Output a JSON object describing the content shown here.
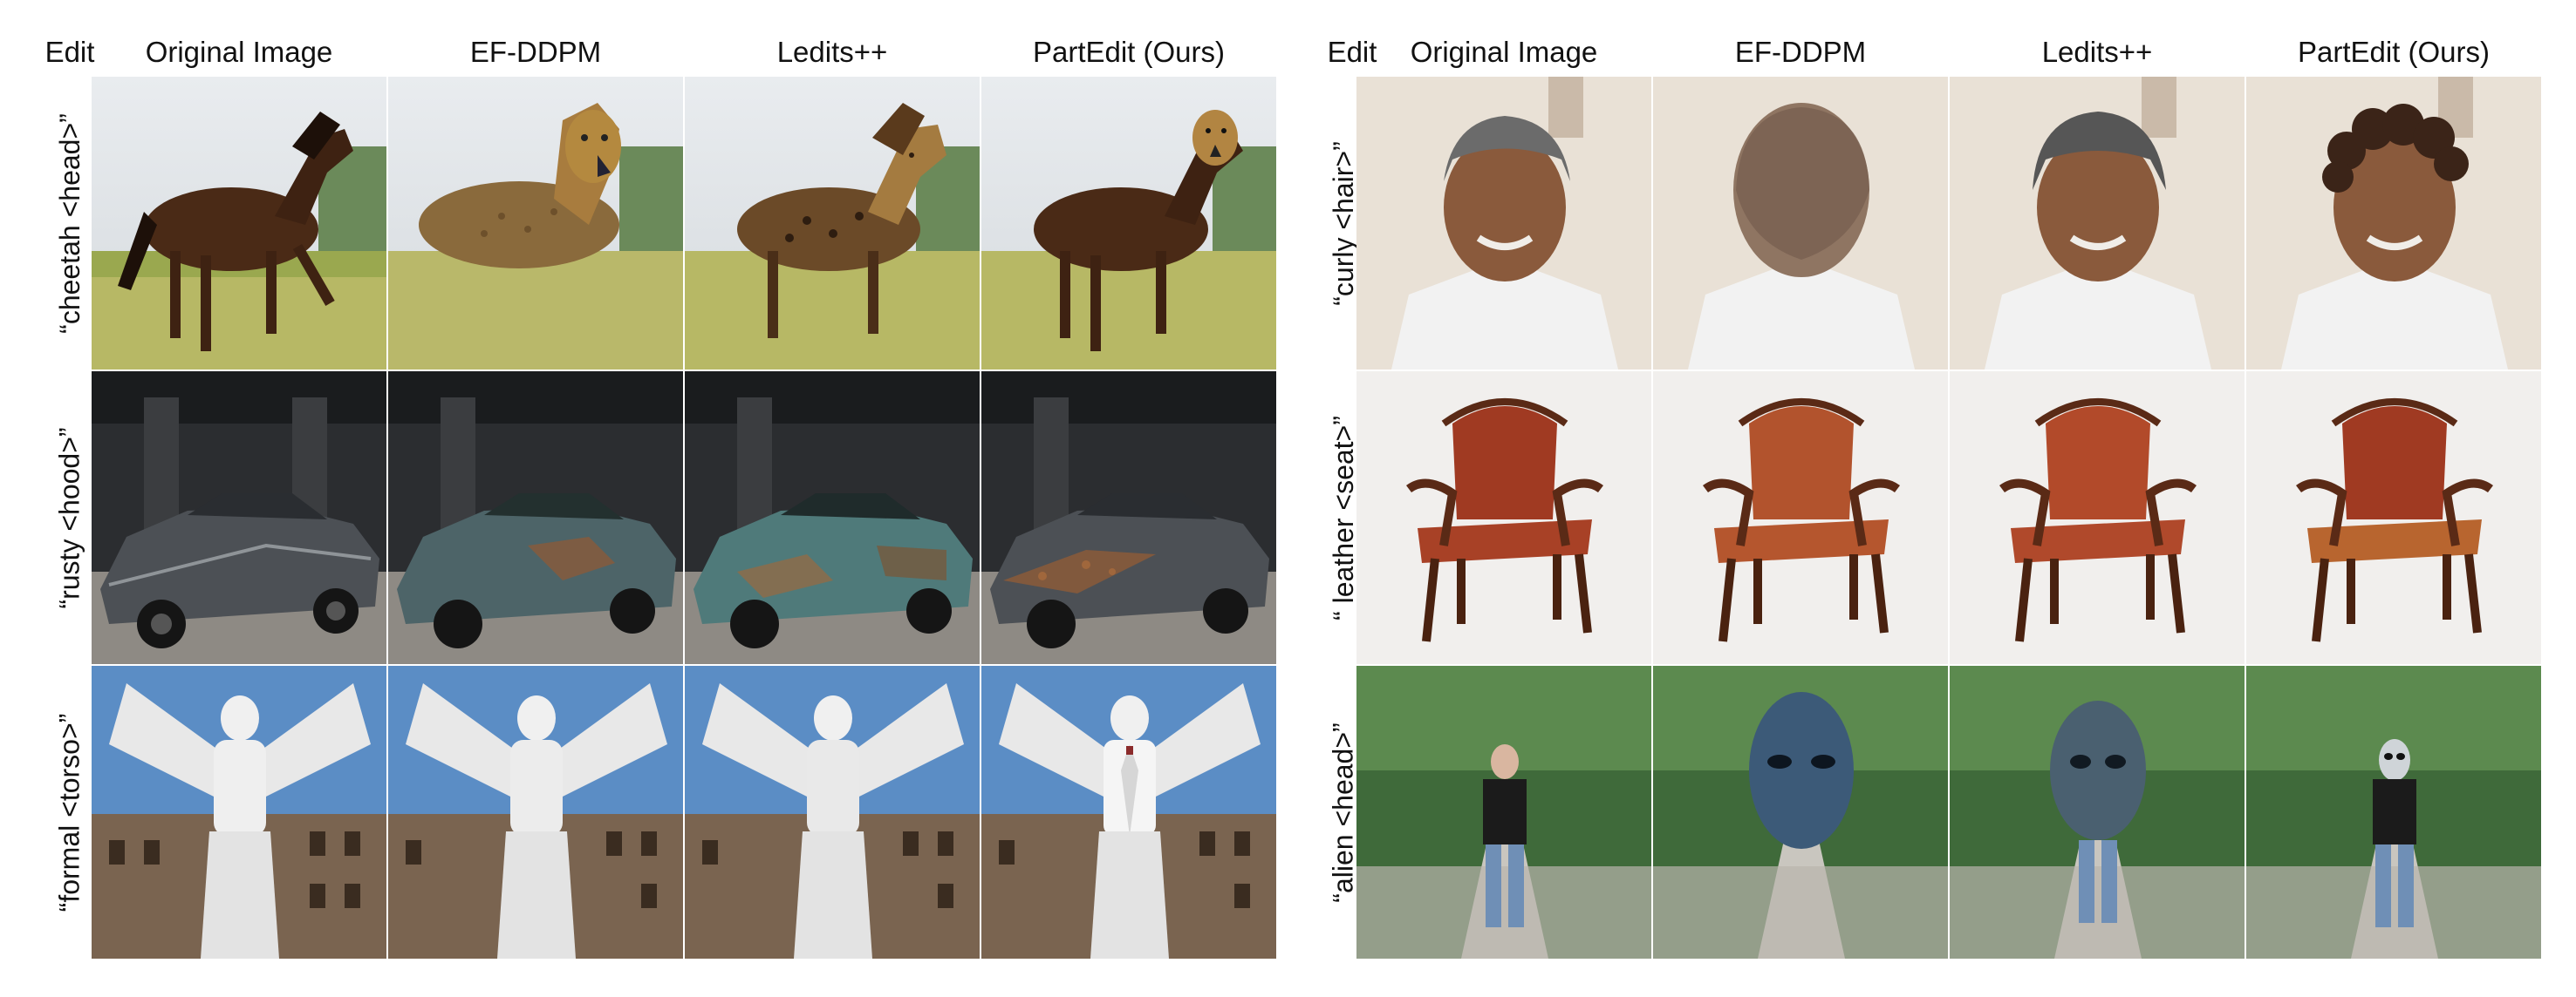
{
  "figure": {
    "left": {
      "edit_header": "Edit",
      "columns": [
        "Original Image",
        "EF-DDPM",
        "Ledits++",
        "PartEdit (Ours)"
      ],
      "rows": [
        {
          "prompt": "“cheetah <head>”",
          "scene": "horse"
        },
        {
          "prompt": "“rusty <hood>”",
          "scene": "car"
        },
        {
          "prompt": "“formal <torso>”",
          "scene": "statue"
        }
      ]
    },
    "right": {
      "edit_header": "Edit",
      "columns": [
        "Original Image",
        "EF-DDPM",
        "Ledits++",
        "PartEdit (Ours)"
      ],
      "rows": [
        {
          "prompt": "“curly <hair>”",
          "scene": "portrait"
        },
        {
          "prompt": "“ leather <seat>”",
          "scene": "chair"
        },
        {
          "prompt": "“alien <head>”",
          "scene": "person-park"
        }
      ]
    }
  }
}
